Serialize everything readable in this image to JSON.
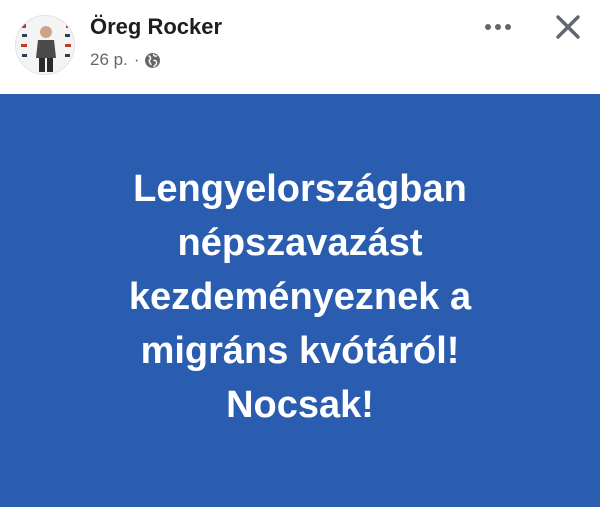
{
  "post": {
    "author": "Öreg Rocker",
    "time": "26 p.",
    "separator": "·",
    "privacy_icon": "globe-icon",
    "more_icon": "more-horizontal-icon",
    "close_icon": "close-icon",
    "avatar": "avatar-person-photo",
    "background_color": "#2a5db0",
    "text_color": "#ffffff",
    "text_lines": [
      "Lengyelországban",
      "népszavazást",
      "kezdeményeznek a",
      "migráns kvótáról!",
      "Nocsak!"
    ]
  }
}
